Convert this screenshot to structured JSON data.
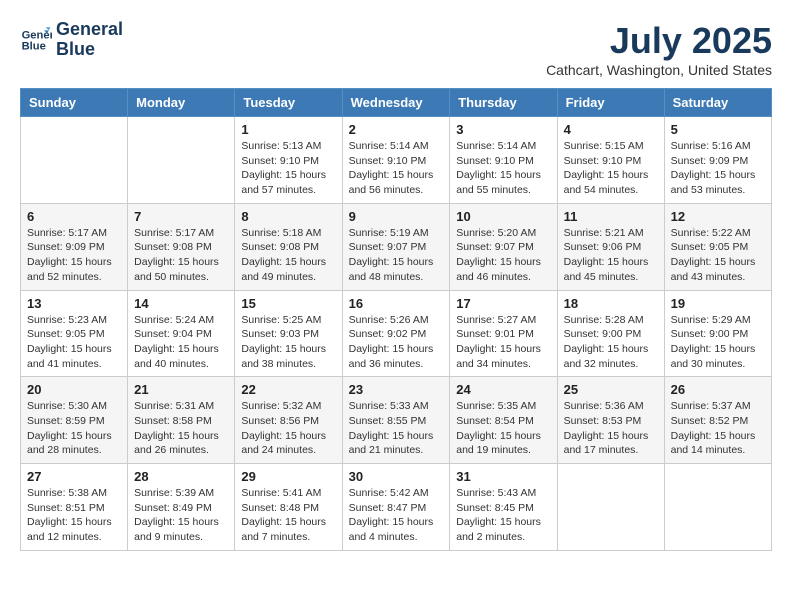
{
  "header": {
    "logo_line1": "General",
    "logo_line2": "Blue",
    "month_year": "July 2025",
    "location": "Cathcart, Washington, United States"
  },
  "weekdays": [
    "Sunday",
    "Monday",
    "Tuesday",
    "Wednesday",
    "Thursday",
    "Friday",
    "Saturday"
  ],
  "weeks": [
    [
      {
        "day": "",
        "info": ""
      },
      {
        "day": "",
        "info": ""
      },
      {
        "day": "1",
        "info": "Sunrise: 5:13 AM\nSunset: 9:10 PM\nDaylight: 15 hours and 57 minutes."
      },
      {
        "day": "2",
        "info": "Sunrise: 5:14 AM\nSunset: 9:10 PM\nDaylight: 15 hours and 56 minutes."
      },
      {
        "day": "3",
        "info": "Sunrise: 5:14 AM\nSunset: 9:10 PM\nDaylight: 15 hours and 55 minutes."
      },
      {
        "day": "4",
        "info": "Sunrise: 5:15 AM\nSunset: 9:10 PM\nDaylight: 15 hours and 54 minutes."
      },
      {
        "day": "5",
        "info": "Sunrise: 5:16 AM\nSunset: 9:09 PM\nDaylight: 15 hours and 53 minutes."
      }
    ],
    [
      {
        "day": "6",
        "info": "Sunrise: 5:17 AM\nSunset: 9:09 PM\nDaylight: 15 hours and 52 minutes."
      },
      {
        "day": "7",
        "info": "Sunrise: 5:17 AM\nSunset: 9:08 PM\nDaylight: 15 hours and 50 minutes."
      },
      {
        "day": "8",
        "info": "Sunrise: 5:18 AM\nSunset: 9:08 PM\nDaylight: 15 hours and 49 minutes."
      },
      {
        "day": "9",
        "info": "Sunrise: 5:19 AM\nSunset: 9:07 PM\nDaylight: 15 hours and 48 minutes."
      },
      {
        "day": "10",
        "info": "Sunrise: 5:20 AM\nSunset: 9:07 PM\nDaylight: 15 hours and 46 minutes."
      },
      {
        "day": "11",
        "info": "Sunrise: 5:21 AM\nSunset: 9:06 PM\nDaylight: 15 hours and 45 minutes."
      },
      {
        "day": "12",
        "info": "Sunrise: 5:22 AM\nSunset: 9:05 PM\nDaylight: 15 hours and 43 minutes."
      }
    ],
    [
      {
        "day": "13",
        "info": "Sunrise: 5:23 AM\nSunset: 9:05 PM\nDaylight: 15 hours and 41 minutes."
      },
      {
        "day": "14",
        "info": "Sunrise: 5:24 AM\nSunset: 9:04 PM\nDaylight: 15 hours and 40 minutes."
      },
      {
        "day": "15",
        "info": "Sunrise: 5:25 AM\nSunset: 9:03 PM\nDaylight: 15 hours and 38 minutes."
      },
      {
        "day": "16",
        "info": "Sunrise: 5:26 AM\nSunset: 9:02 PM\nDaylight: 15 hours and 36 minutes."
      },
      {
        "day": "17",
        "info": "Sunrise: 5:27 AM\nSunset: 9:01 PM\nDaylight: 15 hours and 34 minutes."
      },
      {
        "day": "18",
        "info": "Sunrise: 5:28 AM\nSunset: 9:00 PM\nDaylight: 15 hours and 32 minutes."
      },
      {
        "day": "19",
        "info": "Sunrise: 5:29 AM\nSunset: 9:00 PM\nDaylight: 15 hours and 30 minutes."
      }
    ],
    [
      {
        "day": "20",
        "info": "Sunrise: 5:30 AM\nSunset: 8:59 PM\nDaylight: 15 hours and 28 minutes."
      },
      {
        "day": "21",
        "info": "Sunrise: 5:31 AM\nSunset: 8:58 PM\nDaylight: 15 hours and 26 minutes."
      },
      {
        "day": "22",
        "info": "Sunrise: 5:32 AM\nSunset: 8:56 PM\nDaylight: 15 hours and 24 minutes."
      },
      {
        "day": "23",
        "info": "Sunrise: 5:33 AM\nSunset: 8:55 PM\nDaylight: 15 hours and 21 minutes."
      },
      {
        "day": "24",
        "info": "Sunrise: 5:35 AM\nSunset: 8:54 PM\nDaylight: 15 hours and 19 minutes."
      },
      {
        "day": "25",
        "info": "Sunrise: 5:36 AM\nSunset: 8:53 PM\nDaylight: 15 hours and 17 minutes."
      },
      {
        "day": "26",
        "info": "Sunrise: 5:37 AM\nSunset: 8:52 PM\nDaylight: 15 hours and 14 minutes."
      }
    ],
    [
      {
        "day": "27",
        "info": "Sunrise: 5:38 AM\nSunset: 8:51 PM\nDaylight: 15 hours and 12 minutes."
      },
      {
        "day": "28",
        "info": "Sunrise: 5:39 AM\nSunset: 8:49 PM\nDaylight: 15 hours and 9 minutes."
      },
      {
        "day": "29",
        "info": "Sunrise: 5:41 AM\nSunset: 8:48 PM\nDaylight: 15 hours and 7 minutes."
      },
      {
        "day": "30",
        "info": "Sunrise: 5:42 AM\nSunset: 8:47 PM\nDaylight: 15 hours and 4 minutes."
      },
      {
        "day": "31",
        "info": "Sunrise: 5:43 AM\nSunset: 8:45 PM\nDaylight: 15 hours and 2 minutes."
      },
      {
        "day": "",
        "info": ""
      },
      {
        "day": "",
        "info": ""
      }
    ]
  ]
}
